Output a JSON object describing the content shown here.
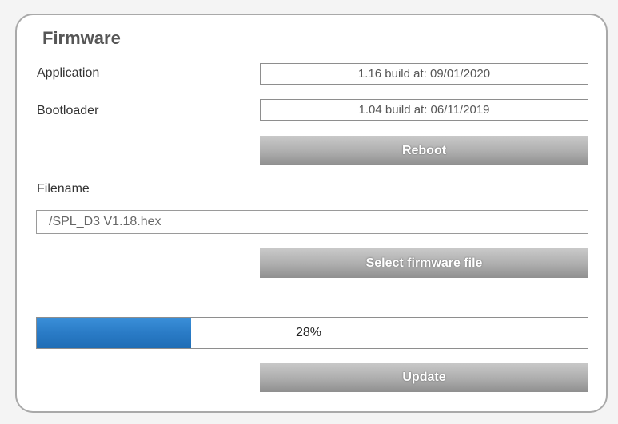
{
  "firmware": {
    "title": "Firmware",
    "application": {
      "label": "Application",
      "value": "1.16 build at: 09/01/2020"
    },
    "bootloader": {
      "label": "Bootloader",
      "value": "1.04 build at: 06/11/2019"
    },
    "reboot_label": "Reboot",
    "filename": {
      "label": "Filename",
      "value": "/SPL_D3 V1.18.hex"
    },
    "select_file_label": "Select firmware file",
    "progress": {
      "percent": 28,
      "text": "28%",
      "fill_color": "#2a7bc6"
    },
    "update_label": "Update"
  }
}
